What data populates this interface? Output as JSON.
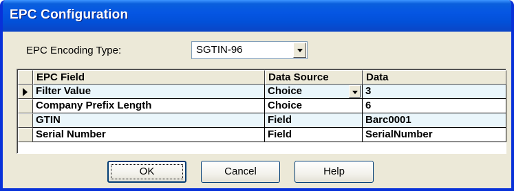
{
  "window": {
    "title": "EPC Configuration"
  },
  "encoding": {
    "label": "EPC Encoding Type:",
    "value": "SGTIN-96"
  },
  "grid": {
    "columns": [
      "EPC Field",
      "Data Source",
      "Data"
    ],
    "rows": [
      {
        "field": "Filter Value",
        "source": "Choice",
        "data": "3",
        "current": true
      },
      {
        "field": "Company Prefix Length",
        "source": "Choice",
        "data": "6"
      },
      {
        "field": "GTIN",
        "source": "Field",
        "data": "Barc0001"
      },
      {
        "field": "Serial Number",
        "source": "Field",
        "data": "SerialNumber"
      }
    ]
  },
  "buttons": {
    "ok": "OK",
    "cancel": "Cancel",
    "help": "Help"
  },
  "colors": {
    "titlebar": "#0250d8",
    "dialog": "#ece9d8",
    "alt_row": "#eaf6fb"
  }
}
